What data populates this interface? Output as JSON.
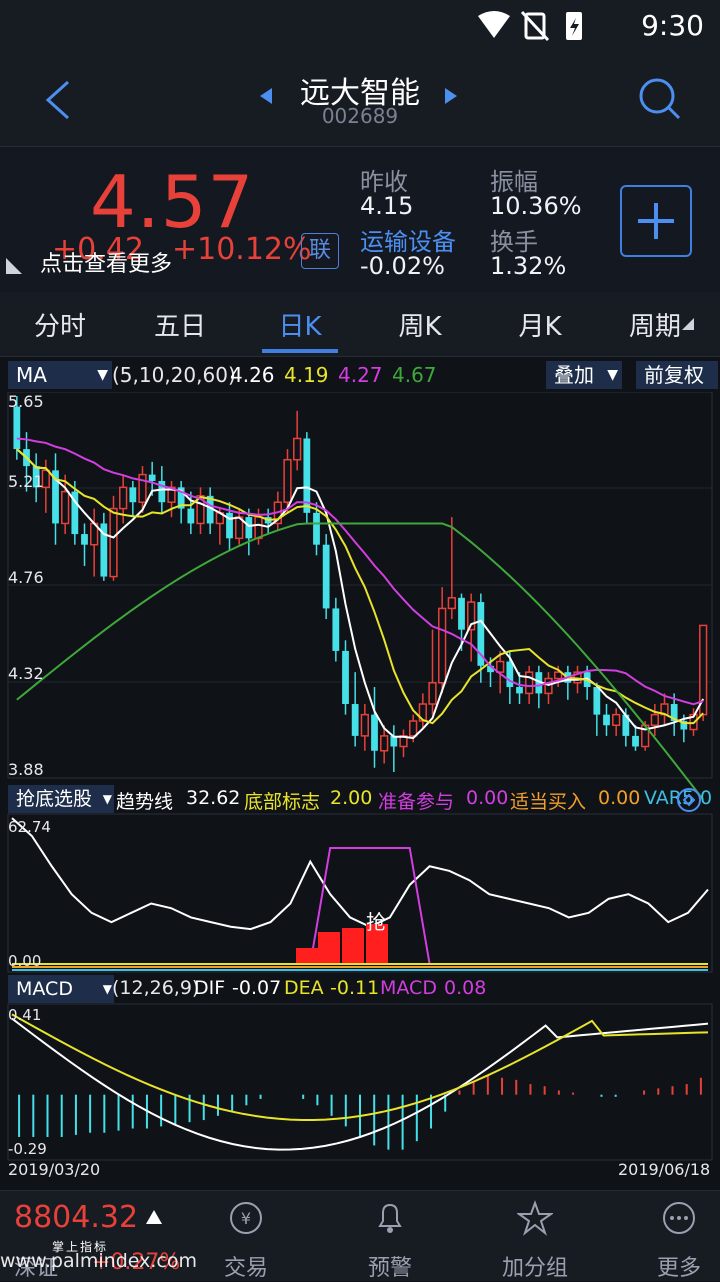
{
  "status": {
    "time": "9:30"
  },
  "header": {
    "title": "远大智能",
    "code": "002689"
  },
  "quote": {
    "price": "4.57",
    "change": "+0.42",
    "change_pct": "+10.12%",
    "tooltip": "点击查看更多",
    "lian_label": "联",
    "prev_close_label": "昨收",
    "prev_close": "4.15",
    "industry_label": "运输设备",
    "industry_change": "-0.02%",
    "amplitude_label": "振幅",
    "amplitude": "10.36%",
    "turnover_label": "换手",
    "turnover": "1.32%"
  },
  "tabs": [
    {
      "label": "分时"
    },
    {
      "label": "五日"
    },
    {
      "label": "日K"
    },
    {
      "label": "周K"
    },
    {
      "label": "月K"
    },
    {
      "label": "周期"
    }
  ],
  "ma_bar": {
    "selector": "MA",
    "params": "(5,10,20,60)",
    "ma5": "4.26",
    "ma10": "4.19",
    "ma20": "4.27",
    "ma60": "4.67",
    "overlay": "叠加",
    "adjust": "前复权"
  },
  "price_axis": {
    "top": "5.65",
    "l2": "5.21",
    "l3": "4.76",
    "l4": "4.32",
    "bottom": "3.88"
  },
  "indicator2": {
    "selector": "抢底选股",
    "trend_label": "趋势线",
    "trend": "32.62",
    "bottom_label": "底部标志",
    "bottom": "2.00",
    "prep_label": "准备参与",
    "prep": "0.00",
    "buy_label": "适当买入",
    "buy": "0.00",
    "var_label": "VAR5",
    "var": "0",
    "top": "62.74",
    "zero": "0.00",
    "mark": "抢"
  },
  "macd_bar": {
    "selector": "MACD",
    "params": "(12,26,9)",
    "dif_label": "DIF",
    "dif": "-0.07",
    "dea_label": "DEA",
    "dea": "-0.11",
    "macd_label": "MACD",
    "macd": "0.08",
    "top": "0.41",
    "bottom": "-0.29",
    "date_start": "2019/03/20",
    "date_end": "2019/06/18"
  },
  "bottom_nav": {
    "index_value": "8804.32",
    "index_name": "深证",
    "index_pct": "+0.27%",
    "caption": "掌上指标",
    "watermark": "www.palmindex.com",
    "items": [
      {
        "label": "交易"
      },
      {
        "label": "预警"
      },
      {
        "label": "加分组"
      },
      {
        "label": "更多"
      }
    ]
  },
  "colors": {
    "up": "#e8413a",
    "down": "#45e0e8",
    "accent": "#3e7fe0",
    "ma5": "#ffffff",
    "ma10": "#e8e42a",
    "ma20": "#d23ee0",
    "ma60": "#3fa83a"
  },
  "chart_data": [
    {
      "type": "candlestick",
      "title": "日K",
      "ylim": [
        3.88,
        5.65
      ],
      "x_range": [
        "2019/03/20",
        "2019/06/18"
      ],
      "y_ticks": [
        5.65,
        5.21,
        4.76,
        4.32,
        3.88
      ],
      "candles": [
        [
          5.6,
          5.4,
          5.65,
          5.35
        ],
        [
          5.4,
          5.32,
          5.48,
          5.2
        ],
        [
          5.32,
          5.22,
          5.38,
          5.15
        ],
        [
          5.22,
          5.3,
          5.35,
          5.1
        ],
        [
          5.3,
          5.05,
          5.38,
          4.95
        ],
        [
          5.05,
          5.2,
          5.28,
          5.0
        ],
        [
          5.2,
          5.0,
          5.25,
          4.95
        ],
        [
          5.0,
          4.95,
          5.05,
          4.85
        ],
        [
          4.95,
          5.05,
          5.12,
          4.8
        ],
        [
          5.05,
          4.8,
          5.1,
          4.78
        ],
        [
          4.8,
          5.12,
          5.18,
          4.78
        ],
        [
          5.12,
          5.22,
          5.28,
          5.05
        ],
        [
          5.22,
          5.15,
          5.25,
          5.08
        ],
        [
          5.15,
          5.28,
          5.32,
          5.1
        ],
        [
          5.28,
          5.25,
          5.34,
          5.18
        ],
        [
          5.25,
          5.15,
          5.32,
          5.1
        ],
        [
          5.15,
          5.22,
          5.25,
          5.08
        ],
        [
          5.22,
          5.12,
          5.25,
          5.05
        ],
        [
          5.12,
          5.05,
          5.2,
          5.0
        ],
        [
          5.05,
          5.18,
          5.22,
          5.0
        ],
        [
          5.18,
          5.05,
          5.22,
          5.0
        ],
        [
          5.05,
          5.1,
          5.12,
          4.95
        ],
        [
          5.1,
          4.98,
          5.15,
          4.92
        ],
        [
          4.98,
          5.08,
          5.12,
          4.95
        ],
        [
          5.08,
          4.98,
          5.12,
          4.9
        ],
        [
          4.98,
          5.08,
          5.12,
          4.95
        ],
        [
          5.08,
          5.05,
          5.12,
          5.0
        ],
        [
          5.05,
          5.15,
          5.2,
          5.02
        ],
        [
          5.15,
          5.35,
          5.4,
          5.1
        ],
        [
          5.35,
          5.45,
          5.58,
          5.3
        ],
        [
          5.45,
          5.1,
          5.48,
          5.05
        ],
        [
          5.1,
          4.95,
          5.15,
          4.9
        ],
        [
          4.95,
          4.65,
          5.0,
          4.6
        ],
        [
          4.65,
          4.45,
          4.7,
          4.4
        ],
        [
          4.45,
          4.2,
          4.5,
          4.15
        ],
        [
          4.2,
          4.05,
          4.35,
          4.0
        ],
        [
          4.05,
          4.15,
          4.2,
          3.98
        ],
        [
          4.15,
          3.98,
          4.28,
          3.9
        ],
        [
          3.98,
          4.05,
          4.1,
          3.92
        ],
        [
          4.05,
          4.0,
          4.1,
          3.88
        ],
        [
          4.0,
          4.05,
          4.08,
          3.95
        ],
        [
          4.05,
          4.12,
          4.15,
          4.02
        ],
        [
          4.12,
          4.2,
          4.25,
          4.08
        ],
        [
          4.2,
          4.3,
          4.55,
          4.15
        ],
        [
          4.3,
          4.65,
          4.75,
          4.25
        ],
        [
          4.65,
          4.7,
          5.08,
          4.6
        ],
        [
          4.7,
          4.55,
          4.72,
          4.45
        ],
        [
          4.55,
          4.68,
          4.72,
          4.4
        ],
        [
          4.68,
          4.38,
          4.72,
          4.3
        ],
        [
          4.38,
          4.35,
          4.42,
          4.28
        ],
        [
          4.35,
          4.4,
          4.45,
          4.25
        ],
        [
          4.4,
          4.28,
          4.45,
          4.2
        ],
        [
          4.28,
          4.25,
          4.35,
          4.2
        ],
        [
          4.25,
          4.35,
          4.38,
          4.2
        ],
        [
          4.35,
          4.25,
          4.38,
          4.18
        ],
        [
          4.25,
          4.32,
          4.35,
          4.2
        ],
        [
          4.32,
          4.35,
          4.38,
          4.28
        ],
        [
          4.35,
          4.3,
          4.38,
          4.22
        ],
        [
          4.3,
          4.35,
          4.38,
          4.25
        ],
        [
          4.35,
          4.28,
          4.38,
          4.22
        ],
        [
          4.28,
          4.15,
          4.3,
          4.05
        ],
        [
          4.15,
          4.1,
          4.2,
          4.05
        ],
        [
          4.1,
          4.15,
          4.18,
          4.05
        ],
        [
          4.15,
          4.05,
          4.18,
          4.0
        ],
        [
          4.05,
          4.0,
          4.1,
          3.98
        ],
        [
          4.0,
          4.1,
          4.12,
          3.98
        ],
        [
          4.1,
          4.15,
          4.2,
          4.05
        ],
        [
          4.15,
          4.2,
          4.25,
          4.1
        ],
        [
          4.2,
          4.12,
          4.25,
          4.05
        ],
        [
          4.12,
          4.08,
          4.15,
          4.02
        ],
        [
          4.08,
          4.15,
          4.18,
          4.05
        ],
        [
          4.15,
          4.57,
          4.57,
          4.12
        ]
      ],
      "ma_series": [
        {
          "name": "MA5",
          "value": 4.26
        },
        {
          "name": "MA10",
          "value": 4.19
        },
        {
          "name": "MA20",
          "value": 4.27
        },
        {
          "name": "MA60",
          "value": 4.67
        }
      ]
    },
    {
      "type": "line",
      "title": "抢底选股",
      "ylim": [
        0.0,
        62.74
      ],
      "series": [
        {
          "name": "趋势线",
          "values": [
            62.7,
            55,
            42,
            30,
            22,
            18,
            22,
            26,
            24,
            20,
            18,
            16,
            15,
            18,
            26,
            44,
            30,
            20,
            16,
            20,
            34,
            42,
            40,
            36,
            30,
            28,
            26,
            24,
            20,
            22,
            28,
            30,
            26,
            18,
            22,
            32
          ]
        },
        {
          "name": "底部标志",
          "values": [
            0,
            0,
            0,
            0,
            0,
            0,
            0,
            0,
            0,
            0,
            0,
            0,
            0,
            0,
            0,
            0,
            2,
            2,
            2,
            2,
            2,
            0,
            0,
            0,
            0,
            0,
            0,
            0,
            0,
            0,
            0,
            0,
            0,
            0,
            0,
            0
          ]
        }
      ]
    },
    {
      "type": "bar",
      "title": "MACD",
      "ylim": [
        -0.29,
        0.41
      ],
      "series": [
        {
          "name": "MACD",
          "values": [
            -0.2,
            -0.2,
            -0.2,
            -0.2,
            -0.19,
            -0.18,
            -0.18,
            -0.17,
            -0.16,
            -0.16,
            -0.15,
            -0.14,
            -0.13,
            -0.12,
            -0.1,
            -0.08,
            -0.05,
            -0.02,
            0,
            0,
            -0.02,
            -0.05,
            -0.1,
            -0.15,
            -0.2,
            -0.24,
            -0.26,
            -0.26,
            -0.22,
            -0.16,
            -0.08,
            0.02,
            0.06,
            0.09,
            0.08,
            0.07,
            0.05,
            0.04,
            0.02,
            0.01,
            0.0,
            -0.01,
            -0.01,
            0.0,
            0.02,
            0.03,
            0.04,
            0.05,
            0.08
          ]
        }
      ]
    }
  ]
}
